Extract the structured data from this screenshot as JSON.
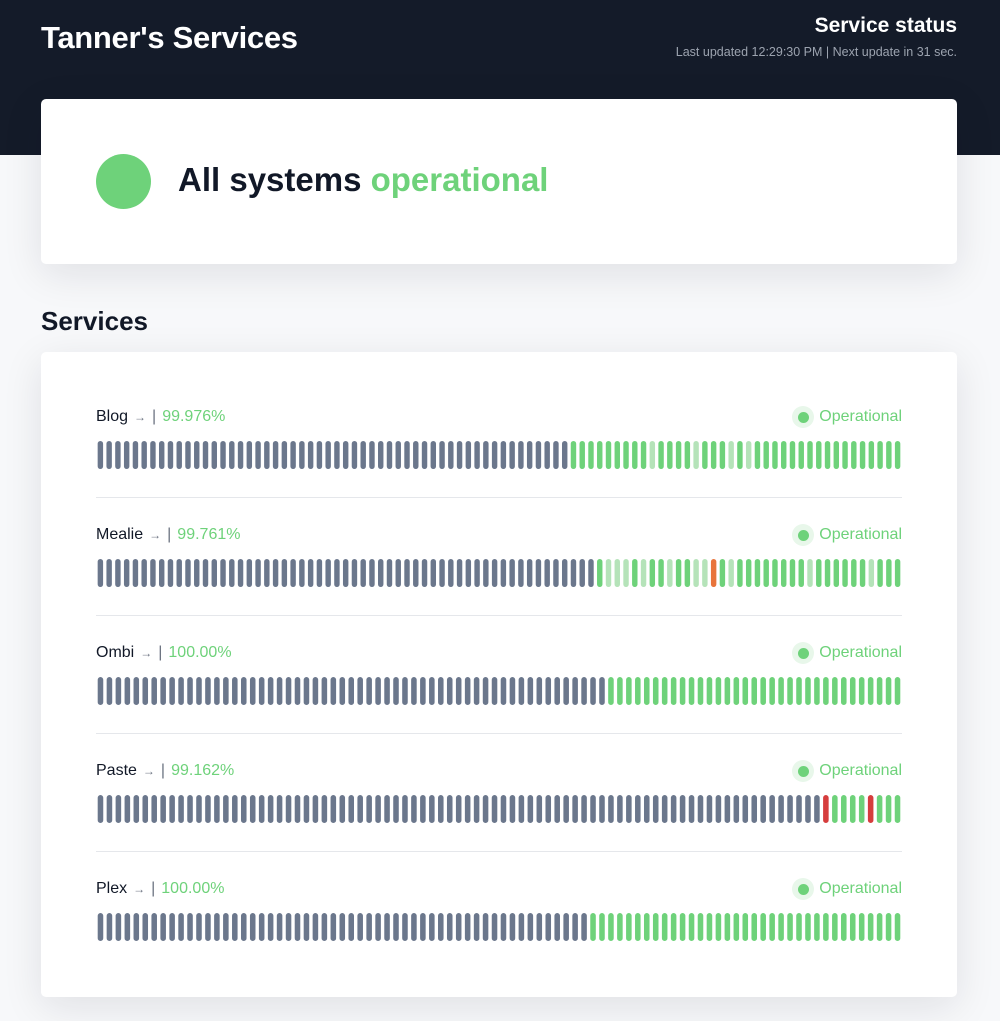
{
  "header": {
    "title": "Tanner's Services",
    "status_heading": "Service status",
    "updated_text": "Last updated 12:29:30 PM | Next update in 31 sec."
  },
  "summary": {
    "text": "All systems",
    "accent": "operational",
    "status": "operational"
  },
  "services_section": {
    "title": "Services",
    "items": [
      {
        "name": "Blog",
        "separator": "|",
        "uptime": "99.976%",
        "status": "Operational",
        "history": "nnnnnnnnnnnnnnnnnnnnnnnnnnnnnnnnnnnnnnnnnnnnnnnnnnnnnnggggggggglgggglggglglggggggggggggggggg"
      },
      {
        "name": "Mealie",
        "separator": "|",
        "uptime": "99.761%",
        "status": "Operational",
        "history": "nnnnnnnnnnnnnnnnnnnnnnnnnnnnnnnnnnnnnnnnnnnnnnnnnnnnnnnnnglllglgglgglloglgggggggglgggggglggg"
      },
      {
        "name": "Ombi",
        "separator": "|",
        "uptime": "100.00%",
        "status": "Operational",
        "history": "nnnnnnnnnnnnnnnnnnnnnnnnnnnnnnnnnnnnnnnnnnnnnnnnnnnnnnnnnggggggggggggggggggggggggggggggggg"
      },
      {
        "name": "Paste",
        "separator": "|",
        "uptime": "99.162%",
        "status": "Operational",
        "history": "nnnnnnnnnnnnnnnnnnnnnnnnnnnnnnnnnnnnnnnnnnnnnnnnnnnnnnnnnnnnnnnnnnnnnnnnnnnnnnnnnrggggrggg"
      },
      {
        "name": "Plex",
        "separator": "|",
        "uptime": "100.00%",
        "status": "Operational",
        "history": "nnnnnnnnnnnnnnnnnnnnnnnnnnnnnnnnnnnnnnnnnnnnnnnnnnnnnnnggggggggggggggggggggggggggggggggggg"
      }
    ]
  },
  "colors": {
    "header_bg": "#141b29",
    "operational": "#6ed27a",
    "degraded_light": "#b5e3b9",
    "no_data": "#6b778c",
    "partial_outage": "#e8743b",
    "major_outage": "#d63d3d"
  }
}
